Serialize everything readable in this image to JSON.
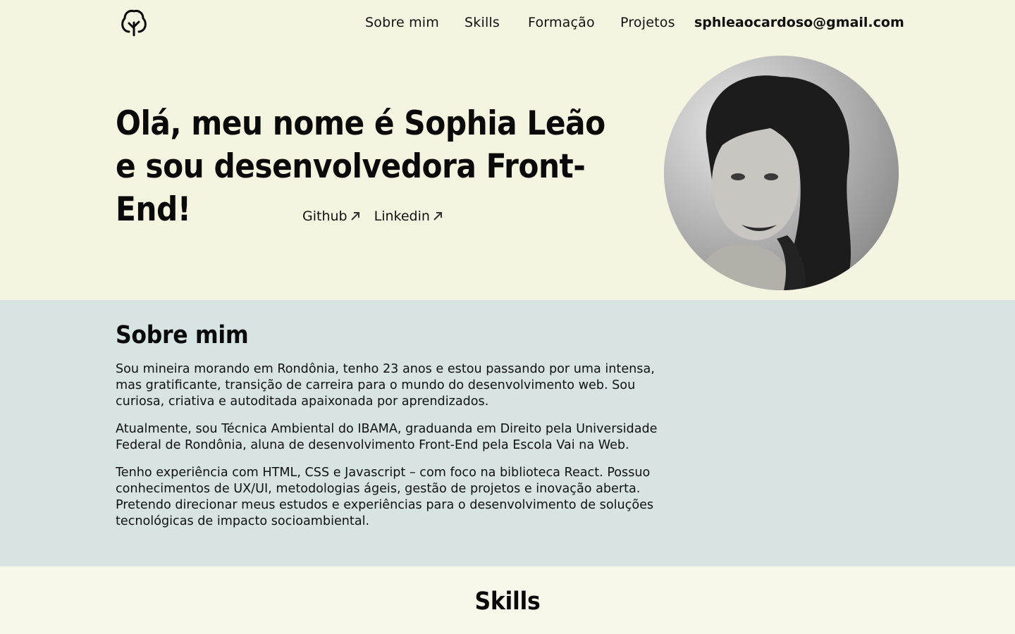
{
  "nav": {
    "logo_icon": "tree-icon",
    "links": [
      "Sobre mim",
      "Skills",
      "Formação",
      "Projetos"
    ],
    "email": "sphleaocardoso@gmail.com"
  },
  "hero": {
    "title": "Olá, meu nome é Sophia Leão e sou desenvolvedora Front-End!",
    "github_label": "Github",
    "linkedin_label": "Linkedin",
    "link_icon": "external-link-arrow-icon"
  },
  "about": {
    "heading": "Sobre mim",
    "paragraphs": [
      "Sou mineira morando em Rondônia, tenho 23 anos e estou passando por uma intensa, mas gratificante, transição de carreira para o mundo do desenvolvimento web. Sou curiosa, criativa e autoditada apaixonada por aprendizados.",
      "Atualmente, sou Técnica Ambiental do IBAMA, graduanda em Direito pela Universidade Federal de Rondônia, aluna de desenvolvimento Front-End pela Escola Vai na Web.",
      "Tenho experiência com HTML, CSS e Javascript – com foco na biblioteca React. Possuo conhecimentos de UX/UI, metodologias ágeis, gestão de projetos e inovação aberta. Pretendo direcionar meus estudos e experiências para o desenvolvimento de soluções tecnológicas de impacto socioambiental."
    ]
  },
  "skills": {
    "heading": "Skills"
  },
  "colors": {
    "hero_bg": "#f4f4e0",
    "about_bg": "#d8e3e3",
    "skills_bg": "#f7f7ea",
    "text": "#111111"
  }
}
